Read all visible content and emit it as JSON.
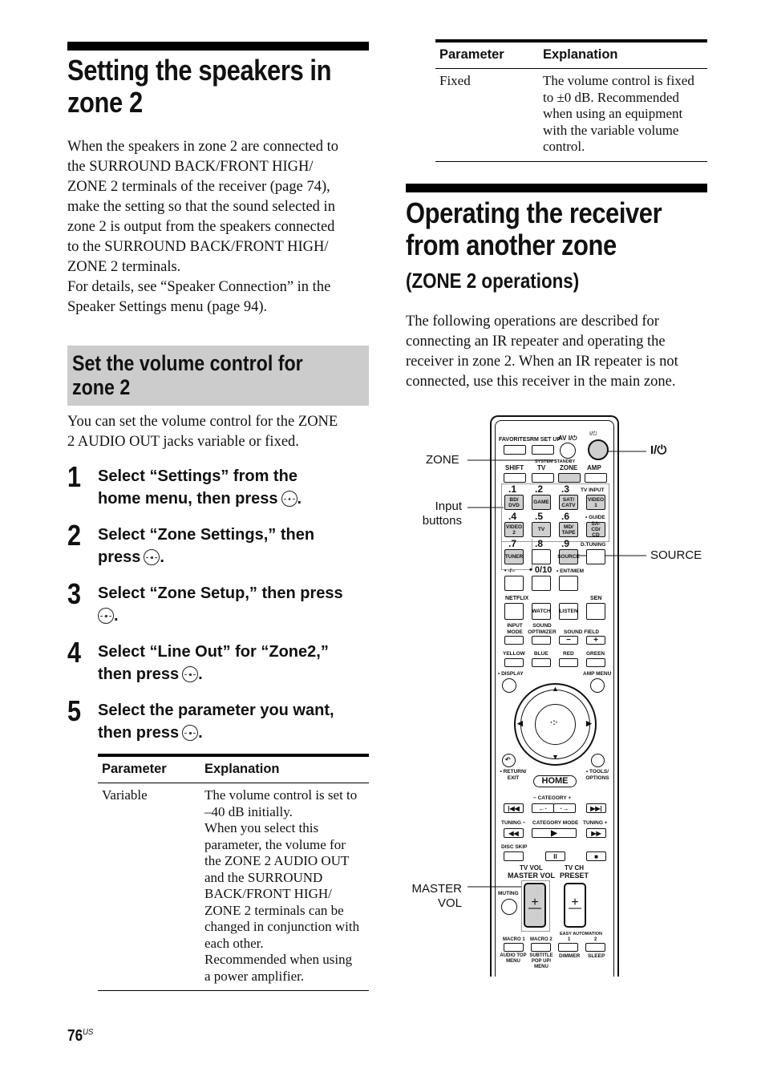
{
  "left": {
    "title_line1": "Setting the speakers in",
    "title_line2": "zone 2",
    "intro": [
      "When the speakers in zone 2 are connected to",
      "the SURROUND BACK/FRONT HIGH/",
      "ZONE 2 terminals of the receiver (page 74),",
      "make the setting so that the sound selected in",
      "zone 2 is output from the speakers connected",
      "to the SURROUND BACK/FRONT HIGH/",
      "ZONE 2 terminals.",
      "For details, see “Speaker Connection” in the",
      "Speaker Settings menu (page 94)."
    ],
    "subhead_line1": "Set the volume control for",
    "subhead_line2": "zone 2",
    "sub_intro": [
      "You can set the volume control for the ZONE",
      "2 AUDIO OUT jacks variable or fixed."
    ],
    "steps": [
      {
        "num": "1",
        "line1": "Select “Settings” from the",
        "line2": "home menu, then press",
        "end": "."
      },
      {
        "num": "2",
        "line1": "Select “Zone Settings,” then",
        "line2": "press",
        "end": "."
      },
      {
        "num": "3",
        "line1": "Select “Zone Setup,” then press",
        "line2": "",
        "end": "."
      },
      {
        "num": "4",
        "line1": "Select “Line Out” for “Zone2,”",
        "line2": "then press",
        "end": "."
      },
      {
        "num": "5",
        "line1": "Select the parameter you want,",
        "line2": "then press",
        "end": "."
      }
    ],
    "table": {
      "headers": [
        "Parameter",
        "Explanation"
      ],
      "rows": [
        {
          "param": "Variable",
          "lines": [
            "The volume control is set to",
            "–40 dB initially.",
            "When you select this",
            "parameter, the volume for",
            "the ZONE 2 AUDIO OUT",
            "and the SURROUND",
            "BACK/FRONT HIGH/",
            "ZONE 2 terminals can be",
            "changed in conjunction with",
            "each other.",
            "Recommended when using",
            "a power amplifier."
          ]
        }
      ]
    },
    "page_number": "76",
    "page_suffix": "US"
  },
  "right": {
    "table": {
      "headers": [
        "Parameter",
        "Explanation"
      ],
      "rows": [
        {
          "param": "Fixed",
          "lines": [
            "The volume control is fixed",
            "to ±0 dB. Recommended",
            "when using an equipment",
            "with the variable volume",
            "control."
          ]
        }
      ]
    },
    "title_line1": "Operating the receiver",
    "title_line2": "from another zone",
    "subtitle": "(ZONE 2 operations)",
    "intro": [
      "The following operations are described for",
      "connecting an IR repeater and operating the",
      "receiver in zone 2. When an IR repeater is not",
      "connected, use this receiver in the main zone."
    ],
    "callouts": {
      "zone": "ZONE",
      "input_1": "Input",
      "input_2": "buttons",
      "power": "I/⏻",
      "source": "SOURCE",
      "mastervol_1": "MASTER",
      "mastervol_2": "VOL"
    },
    "remote": {
      "favorites": "FAVORITES",
      "rm_setup": "RM SET UP",
      "av_power": "AV I/⏻",
      "power": "I/⏻",
      "system_standby": "SYSTEM STANDBY",
      "shift": "SHIFT",
      "tv": "TV",
      "zone": "ZONE",
      "amp": "AMP",
      "n1": ".1",
      "n2": ".2",
      "n3": ".3",
      "tv_input": "TV INPUT",
      "bd_dvd": "BD/ DVD",
      "game": "GAME",
      "sat_catv": "SAT/ CATV",
      "video1": "VIDEO 1",
      "n4": ".4",
      "n5": ".5",
      "n6": ".6",
      "guide": "• GUIDE",
      "video2": "VIDEO 2",
      "tv_btn": "TV",
      "md_tape": "MD/ TAPE",
      "sacd_cd": "SA-CD/ CD",
      "n7": ".7",
      "n8": ".8",
      "n9": ".9",
      "d_tuning": "D.TUNING",
      "tuner": "TUNER",
      "source": "SOURCE",
      "dash": "• -/--",
      "zero10": "• 0/10",
      "ent_mem": "• ENT/MEM",
      "netflix": "NETFLIX",
      "sen": "SEN",
      "watch": "WATCH",
      "listen": "LISTEN",
      "input_mode": "INPUT MODE",
      "sound_optimizer": "SOUND OPTIMIZER",
      "sound_field": "SOUND FIELD",
      "minus": "−",
      "plus": "+",
      "yellow": "YELLOW",
      "blue": "BLUE",
      "red": "RED",
      "green": "GREEN",
      "display": "• DISPLAY",
      "amp_menu": "AMP MENU",
      "return_exit": "• RETURN/ EXIT",
      "tools_options": "• TOOLS/ OPTIONS",
      "home": "HOME",
      "category": "− CATEGORY +",
      "tuning_minus": "TUNING −",
      "category_mode": "CATEGORY MODE",
      "tuning_plus": "TUNING +",
      "disc_skip": "DISC SKIP",
      "tv_vol": "TV VOL",
      "master_vol": "MASTER VOL",
      "tv_ch": "TV CH",
      "preset": "PRESET",
      "muting": "MUTING",
      "macro1": "MACRO 1",
      "macro2": "MACRO 2",
      "easy_automation": "EASY AUTOMATION",
      "ea1": "1",
      "ea2": "2",
      "audio_top_menu": "AUDIO TOP MENU",
      "subtitle_popup": "SUBTITLE POP UP/ MENU",
      "dimmer": "DIMMER",
      "sleep": "SLEEP"
    }
  }
}
